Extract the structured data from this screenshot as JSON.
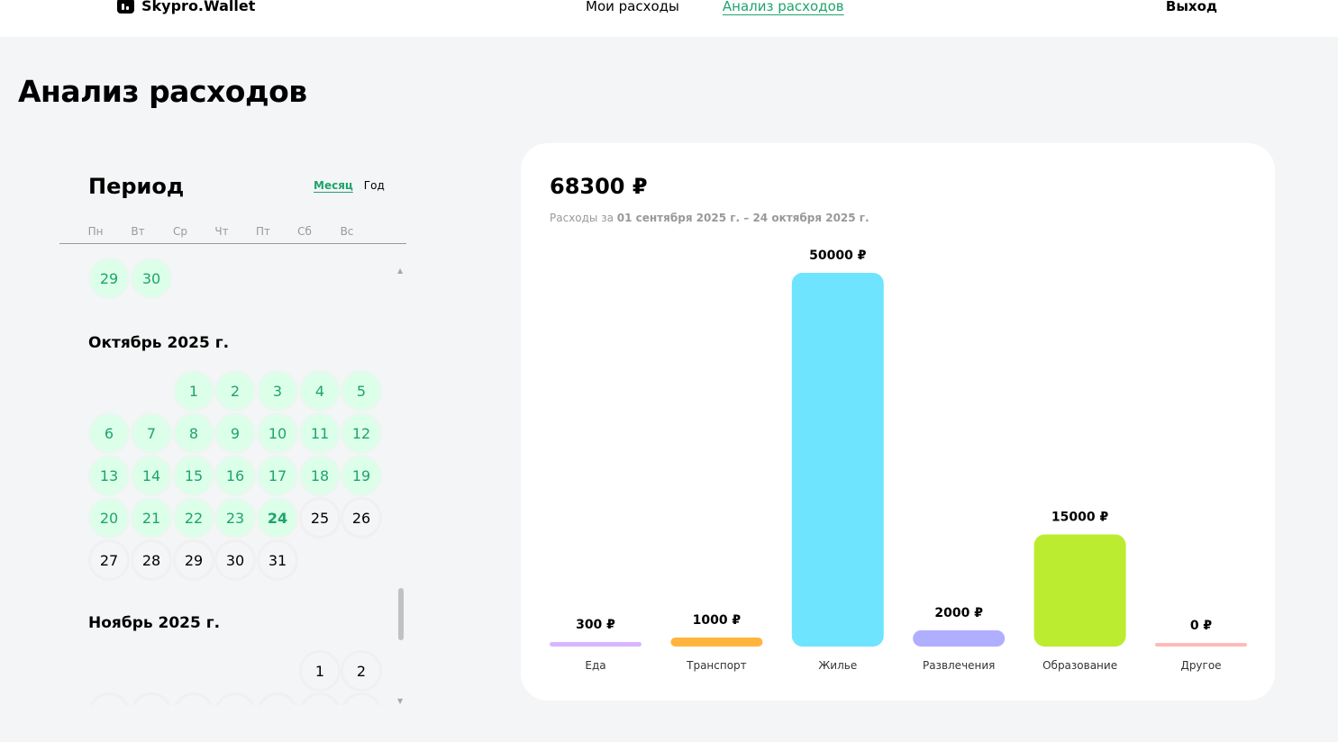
{
  "header": {
    "logo_text": "Skypro.Wallet",
    "nav": [
      {
        "label": "Мои расходы",
        "active": false
      },
      {
        "label": "Анализ расходов",
        "active": true
      }
    ],
    "logout_label": "Выход",
    "accent_color": "#1fa46c"
  },
  "page": {
    "title": "Анализ расходов"
  },
  "calendar": {
    "title": "Период",
    "modes": [
      {
        "label": "Месяц",
        "active": true
      },
      {
        "label": "Год",
        "active": false
      }
    ],
    "weekdays": [
      "Пн",
      "Вт",
      "Ср",
      "Чт",
      "Пт",
      "Сб",
      "Вс"
    ],
    "selected_color": "#dbffe9",
    "months": [
      {
        "label": "",
        "start_weekday": 0,
        "days": [
          29,
          30
        ],
        "selected": [
          29,
          30
        ],
        "partial_top": true
      },
      {
        "label": "Октябрь 2025 г.",
        "start_weekday": 2,
        "days": [
          1,
          2,
          3,
          4,
          5,
          6,
          7,
          8,
          9,
          10,
          11,
          12,
          13,
          14,
          15,
          16,
          17,
          18,
          19,
          20,
          21,
          22,
          23,
          24,
          25,
          26,
          27,
          28,
          29,
          30,
          31
        ],
        "selected": [
          1,
          2,
          3,
          4,
          5,
          6,
          7,
          8,
          9,
          10,
          11,
          12,
          13,
          14,
          15,
          16,
          17,
          18,
          19,
          20,
          21,
          22,
          23,
          24
        ],
        "today": 24
      },
      {
        "label": "Ноябрь 2025 г.",
        "start_weekday": 5,
        "days": [
          1,
          2,
          3,
          4,
          5,
          6,
          7,
          8,
          9
        ],
        "selected": []
      }
    ]
  },
  "summary": {
    "total": "68300 ₽",
    "subtitle_prefix": "Расходы за ",
    "subtitle_range": "01 сентября 2025 г. – 24 октября 2025 г."
  },
  "chart_data": {
    "type": "bar",
    "categories": [
      "Еда",
      "Транспорт",
      "Жилье",
      "Развлечения",
      "Образование",
      "Другое"
    ],
    "values": [
      300,
      1000,
      50000,
      2000,
      15000,
      0
    ],
    "value_labels": [
      "300 ₽",
      "1000 ₽",
      "50000 ₽",
      "2000 ₽",
      "15000 ₽",
      "0 ₽"
    ],
    "colors": [
      "#d9b6ff",
      "#ffb53d",
      "#6ee4fe",
      "#b0aeff",
      "#bcec30",
      "#ffb9b8"
    ],
    "ylim": [
      0,
      50000
    ]
  }
}
